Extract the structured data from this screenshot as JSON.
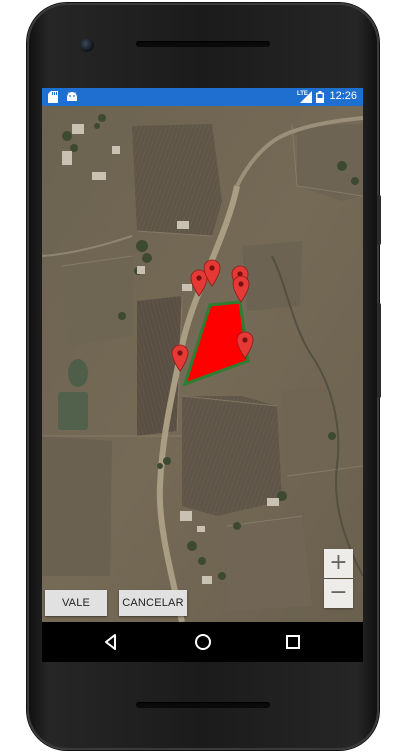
{
  "statusbar": {
    "time": "12:26",
    "network": "LTE",
    "icons": [
      "sd-card-icon",
      "android-icon",
      "signal-icon",
      "battery-icon"
    ]
  },
  "map": {
    "polygon_color": "#ff0000",
    "polygon_outline_color": "#2e7d32",
    "marker_color": "#e53935",
    "marker_count": 6
  },
  "buttons": {
    "ok_label": "VALE",
    "cancel_label": "CANCELAR"
  },
  "zoom": {
    "in_label": "+",
    "out_label": "−"
  },
  "navbar": {
    "icons": [
      "back-icon",
      "home-icon",
      "recents-icon"
    ]
  }
}
